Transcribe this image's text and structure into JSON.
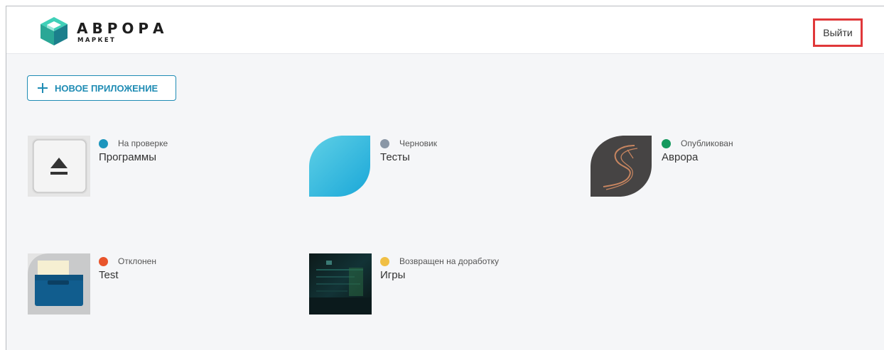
{
  "brand": {
    "title": "АВРОРА",
    "subtitle": "МАРКЕТ",
    "colors": {
      "top": "#3fd0b8",
      "left": "#2aa796",
      "right": "#1b7f8c"
    }
  },
  "header": {
    "logout_label": "Выйти",
    "highlight_color": "#e0383a"
  },
  "toolbar": {
    "new_app_label": "НОВОЕ ПРИЛОЖЕНИЕ",
    "accent": "#1f8cb4"
  },
  "apps": [
    {
      "name": "Программы",
      "status": "На проверке",
      "status_color": "#1c95bd",
      "icon": "eject-icon"
    },
    {
      "name": "Тесты",
      "status": "Черновик",
      "status_color": "#8a97a6",
      "icon": "leaf-icon"
    },
    {
      "name": "Аврора",
      "status": "Опубликован",
      "status_color": "#14995e",
      "icon": "aurora-s-icon"
    },
    {
      "name": "Test",
      "status": "Отклонен",
      "status_color": "#e8542b",
      "icon": "folder-icon"
    },
    {
      "name": "Игры",
      "status": "Возвращен на доработку",
      "status_color": "#f0bf45",
      "icon": "screenshot-thumbnail-icon"
    }
  ]
}
